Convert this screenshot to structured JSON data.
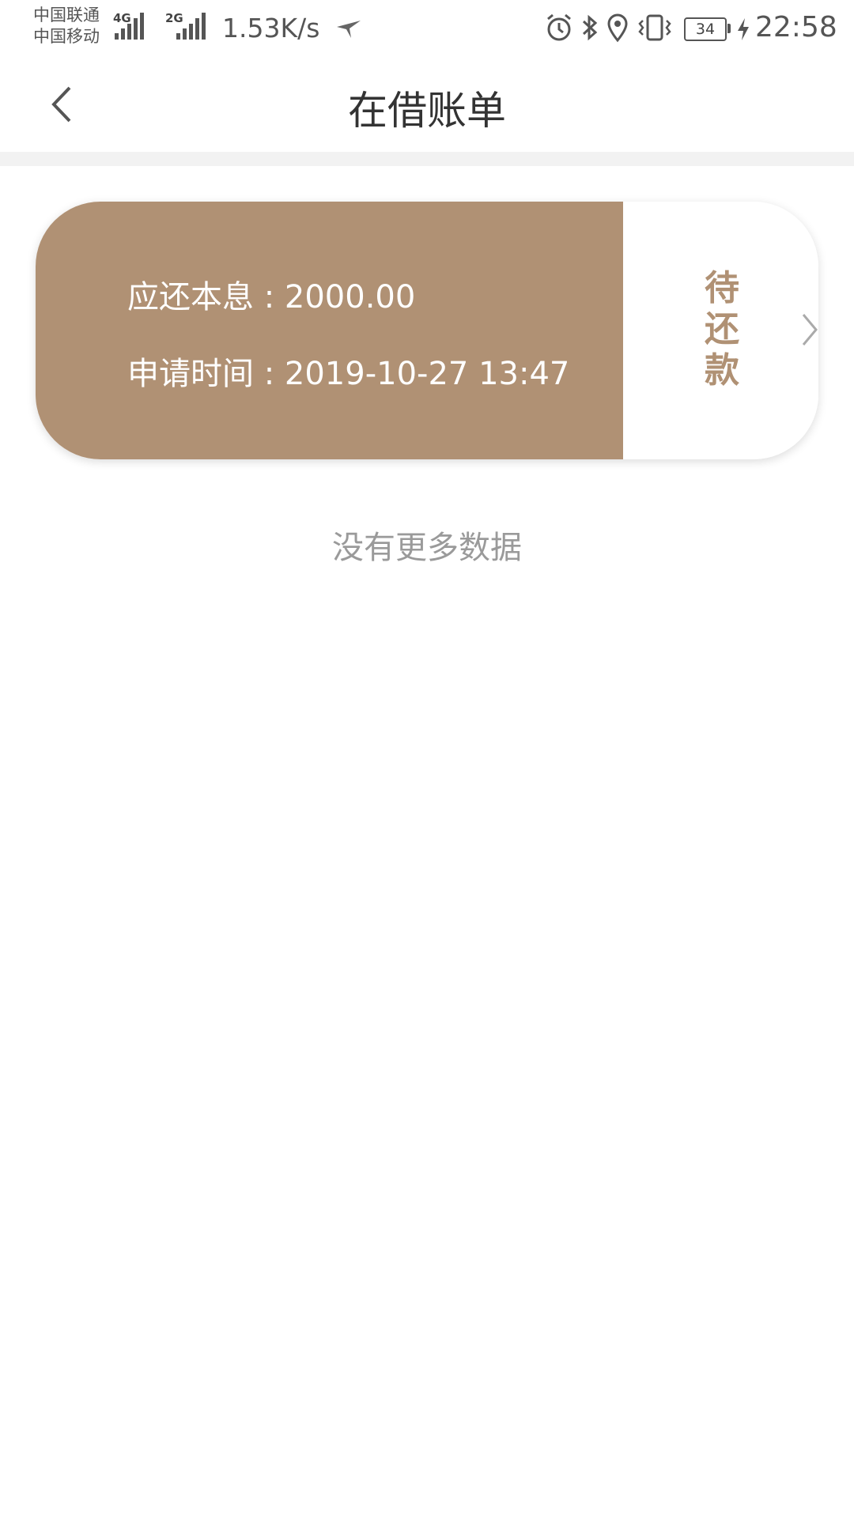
{
  "status_bar": {
    "carrier_1": "中国联通",
    "carrier_2": "中国移动",
    "net_type_1": "4G",
    "net_type_2": "2G",
    "net_speed": "1.53K/s",
    "battery_level": "34",
    "time": "22:58"
  },
  "nav": {
    "title": "在借账单"
  },
  "loan": {
    "principal_label": "应还本息 : ",
    "principal_value": "2000.00",
    "apply_time_label": "申请时间 : ",
    "apply_time_value": "2019-10-27 13:47",
    "status_chars": [
      "待",
      "还",
      "款"
    ]
  },
  "footer": {
    "no_more_text": "没有更多数据"
  },
  "colors": {
    "accent": "#b09174",
    "divider": "#f2f2f2",
    "muted_text": "#9a9a9a"
  }
}
